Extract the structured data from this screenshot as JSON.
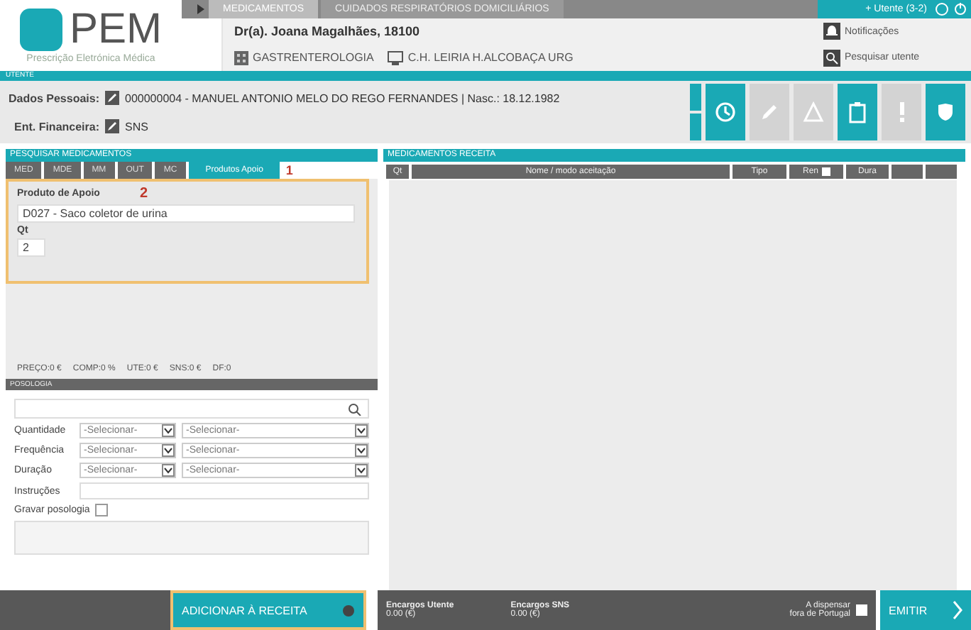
{
  "logo": {
    "title": "PEM",
    "subtitle": "Prescrição Eletrónica Médica"
  },
  "top_tabs": [
    {
      "label": "MEDICAMENTOS",
      "selected": true
    },
    {
      "label": "CUIDADOS RESPIRATÓRIOS DOMICILIÁRIOS",
      "selected": false
    }
  ],
  "prescriber": {
    "name": "Dr(a). Joana Magalhães, 18100",
    "specialty": "GASTRENTEROLOGIA",
    "location": "C.H. LEIRIA H.ALCOBAÇA URG"
  },
  "user_menu": {
    "label": "+ Utente (3-2)"
  },
  "side_links": [
    {
      "kind": "bell",
      "label": "Notificações"
    },
    {
      "kind": "search",
      "label": "Pesquisar utente"
    }
  ],
  "patient": {
    "section": "UTENTE",
    "fields": [
      {
        "label": "Dados Pessoais:",
        "value": "000000004 - MANUEL ANTONIO MELO DO REGO FERNANDES | Nasc.: 18.12.1982"
      },
      {
        "label": "Ent. Financeira:",
        "value": "SNS"
      }
    ],
    "actions": [
      {
        "kind": "clock",
        "enabled": true
      },
      {
        "kind": "pencil",
        "enabled": false
      },
      {
        "kind": "warning",
        "enabled": false
      },
      {
        "kind": "clipboard",
        "enabled": true
      },
      {
        "kind": "exclamation",
        "enabled": false
      },
      {
        "kind": "shield",
        "enabled": true
      }
    ]
  },
  "search": {
    "title": "PESQUISAR MEDICAMENTOS",
    "tabs": [
      {
        "label": "MED",
        "selected": false
      },
      {
        "label": "MDE",
        "selected": false
      },
      {
        "label": "MM",
        "selected": false
      },
      {
        "label": "OUT",
        "selected": false
      },
      {
        "label": "MC",
        "selected": false
      },
      {
        "label": "Produtos Apoio",
        "selected": true
      }
    ],
    "tab_marker": "1",
    "product": {
      "label": "Produto de Apoio",
      "marker": "2",
      "value": "D027 - Saco coletor de urina"
    },
    "quantity": {
      "label": "Qt",
      "value": "2"
    },
    "stats": [
      "PREÇO:0 €",
      "COMP:0 %",
      "UTE:0 €",
      "SNS:0 €",
      "DF:0"
    ]
  },
  "posology": {
    "title": "POSOLOGIA",
    "rows": [
      {
        "label": "Quantidade",
        "select_1": "-Selecionar-",
        "select_2": "-Selecionar-"
      },
      {
        "label": "Frequência",
        "select_1": "-Selecionar-",
        "select_2": "-Selecionar-"
      },
      {
        "label": "Duração",
        "select_1": "-Selecionar-",
        "select_2": "-Selecionar-"
      }
    ],
    "instructions": "Instruções",
    "save": {
      "label": "Gravar posologia",
      "checked": false
    }
  },
  "add_button": "ADICIONAR À RECEITA",
  "receita": {
    "title": "MEDICAMENTOS RECEITA",
    "columns": [
      {
        "label": "Qt"
      },
      {
        "label": "Nome / modo aceitação"
      },
      {
        "label": "Tipo"
      },
      {
        "label": "Ren",
        "checked": false
      },
      {
        "label": "Dura"
      }
    ]
  },
  "footer": {
    "charges": [
      {
        "label": "Encargos Utente",
        "value": "0.00 (€)"
      },
      {
        "label": "Encargos SNS",
        "value": "0.00 (€)"
      }
    ],
    "abroad": {
      "line_1": "A dispensar",
      "line_2": "fora de Portugal",
      "checked": false
    },
    "emit": "EMITIR"
  }
}
